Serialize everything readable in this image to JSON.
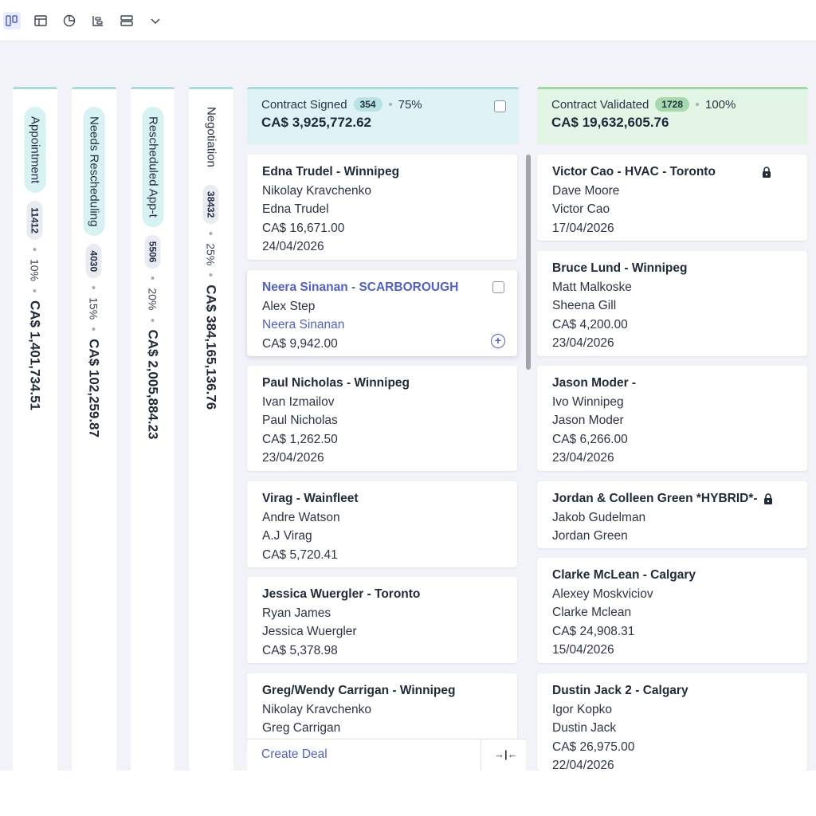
{
  "toolbar": {
    "icons": [
      "kanban-view-icon",
      "table-view-icon",
      "chart-view-icon",
      "timeline-view-icon",
      "list-view-icon",
      "chevron-down-icon"
    ]
  },
  "collapsed_stages": [
    {
      "name": "Appointment",
      "count": "11412",
      "percent": "10%",
      "amount": "CA$ 1,401,734.51"
    },
    {
      "name": "Needs Rescheduling",
      "count": "4030",
      "percent": "15%",
      "amount": "CA$ 102,259.87"
    },
    {
      "name": "Rescheduled App-t",
      "count": "5506",
      "percent": "20%",
      "amount": "CA$ 2,005,884.23"
    },
    {
      "name": "Negotiation",
      "count": "38432",
      "percent": "25%",
      "amount": "CA$ 384,165,136.76"
    }
  ],
  "contract_signed": {
    "name": "Contract Signed",
    "count": "354",
    "percent": "75%",
    "amount": "CA$ 3,925,772.62",
    "color": "#dff3f7",
    "border": "#a7dcdc",
    "badge_color": "#b6e3e3",
    "cards": [
      {
        "title": "Edna Trudel - Winnipeg",
        "lines": [
          "Nikolay Kravchenko",
          "Edna Trudel",
          "CA$ 16,671.00",
          "24/04/2026"
        ]
      },
      {
        "title": "Neera Sinanan - SCARBOROUGH",
        "lines": [
          "Alex Step",
          "Neera Sinanan",
          "CA$ 9,942.00"
        ]
      },
      {
        "title": "Paul Nicholas - Winnipeg",
        "lines": [
          "Ivan Izmailov",
          "Paul Nicholas",
          "CA$ 1,262.50",
          "23/04/2026"
        ]
      },
      {
        "title": "Virag - Wainfleet",
        "lines": [
          "Andre Watson",
          "A.J Virag",
          "CA$ 5,720.41"
        ]
      },
      {
        "title": "Jessica Wuergler - Toronto",
        "lines": [
          "Ryan James",
          "Jessica Wuergler",
          "CA$ 5,378.98"
        ]
      },
      {
        "title": "Greg/Wendy Carrigan - Winnipeg",
        "lines": [
          "Nikolay Kravchenko",
          "Greg Carrigan"
        ]
      }
    ],
    "footer": {
      "create_label": "Create Deal",
      "collapse_label": "→|←"
    }
  },
  "contract_validated": {
    "name": "Contract Validated",
    "count": "1728",
    "percent": "100%",
    "amount": "CA$ 19,632,605.76",
    "color": "#e3f5e5",
    "border": "#9fd7a6",
    "badge_color": "#a6d9ab",
    "cards": [
      {
        "title": "Victor Cao - HVAC - Toronto",
        "lines": [
          "Dave Moore",
          "Victor Cao",
          "17/04/2026"
        ]
      },
      {
        "title": "Bruce Lund - Winnipeg",
        "lines": [
          "Matt Malkoske",
          "Sheena Gill",
          "CA$ 4,200.00",
          "23/04/2026"
        ]
      },
      {
        "title": "Jason Moder -",
        "lines": [
          "Ivo Winnipeg",
          "Jason Moder",
          "CA$ 6,266.00",
          "23/04/2026"
        ]
      },
      {
        "title": "Jordan & Colleen Green *HYBRID*-",
        "lines": [
          "Jakob Gudelman",
          "Jordan Green"
        ]
      },
      {
        "title": "Clarke McLean - Calgary",
        "lines": [
          "Alexey Moskviciov",
          "Clarke Mclean",
          "CA$ 24,908.31",
          "15/04/2026"
        ]
      },
      {
        "title": "Dustin Jack 2 - Calgary",
        "lines": [
          "Igor Kopko",
          "Dustin Jack",
          "CA$ 26,975.00",
          "22/04/2026"
        ]
      }
    ]
  }
}
